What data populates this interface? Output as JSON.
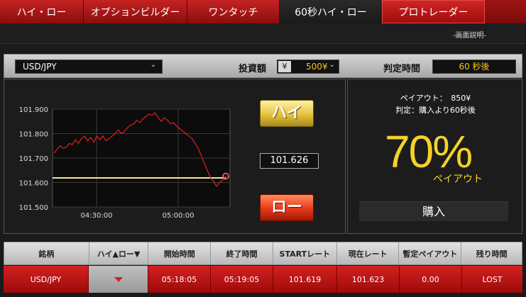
{
  "tabs": [
    {
      "label": "ハイ・ロー",
      "width": 118
    },
    {
      "label": "オプションビルダー",
      "width": 146
    },
    {
      "label": "ワンタッチ",
      "width": 130
    },
    {
      "label": "60秒ハイ・ロー",
      "width": 144,
      "active": true
    },
    {
      "label": "プロトレーダー",
      "width": 145,
      "pro": true
    }
  ],
  "explain_link": "-画面説明-",
  "controls": {
    "pair": "USD/JPY",
    "amount_label": "投資額",
    "amount_currency": "¥",
    "amount_value": "500¥",
    "judge_label": "判定時間",
    "judge_value": "60 秒後"
  },
  "trade": {
    "high_label": "ハイ",
    "low_label": "ロー",
    "current_rate": "101.626"
  },
  "payout": {
    "line1": "ペイアウト：　850¥",
    "line2": "判定：購入より60秒後",
    "percent": "70%",
    "percent_sub": "ペイアウト",
    "buy_label": "購入"
  },
  "chart_data": {
    "type": "line",
    "y_ticks": [
      "101.900",
      "101.800",
      "101.700",
      "101.600",
      "101.500"
    ],
    "x_ticks": [
      "04:30:00",
      "05:00:00"
    ],
    "ylim": [
      101.5,
      101.9
    ],
    "strike": 101.619,
    "colors": {
      "line": "#e02020",
      "strike": "#f5e6a0",
      "grid": "#3a3a3a",
      "end": "#ff7070"
    },
    "values": [
      101.72,
      101.735,
      101.75,
      101.74,
      101.745,
      101.76,
      101.755,
      101.775,
      101.76,
      101.78,
      101.79,
      101.77,
      101.785,
      101.765,
      101.79,
      101.775,
      101.79,
      101.77,
      101.78,
      101.79,
      101.8,
      101.815,
      101.8,
      101.81,
      101.825,
      101.835,
      101.84,
      101.855,
      101.845,
      101.86,
      101.87,
      101.88,
      101.875,
      101.885,
      101.865,
      101.85,
      101.865,
      101.855,
      101.84,
      101.845,
      101.83,
      101.82,
      101.81,
      101.8,
      101.79,
      101.78,
      101.76,
      101.74,
      101.71,
      101.68,
      101.65,
      101.62,
      101.605,
      101.585,
      101.6,
      101.61,
      101.626
    ]
  },
  "table": {
    "headers": [
      {
        "label": "銘柄",
        "width": 120
      },
      {
        "label": "ハイ▲ロー▼",
        "width": 84
      },
      {
        "label": "開始時間",
        "width": 88
      },
      {
        "label": "終了時間",
        "width": 88
      },
      {
        "label": "STARTレート",
        "width": 90
      },
      {
        "label": "現在レート",
        "width": 88
      },
      {
        "label": "暫定ペイアウト",
        "width": 88
      },
      {
        "label": "残り時間",
        "width": 85
      }
    ],
    "row": {
      "pair": "USD/JPY",
      "start_time": "05:18:05",
      "end_time": "05:19:05",
      "start_rate": "101.619",
      "current_rate": "101.623",
      "payout": "0.00",
      "remaining": "LOST"
    }
  }
}
